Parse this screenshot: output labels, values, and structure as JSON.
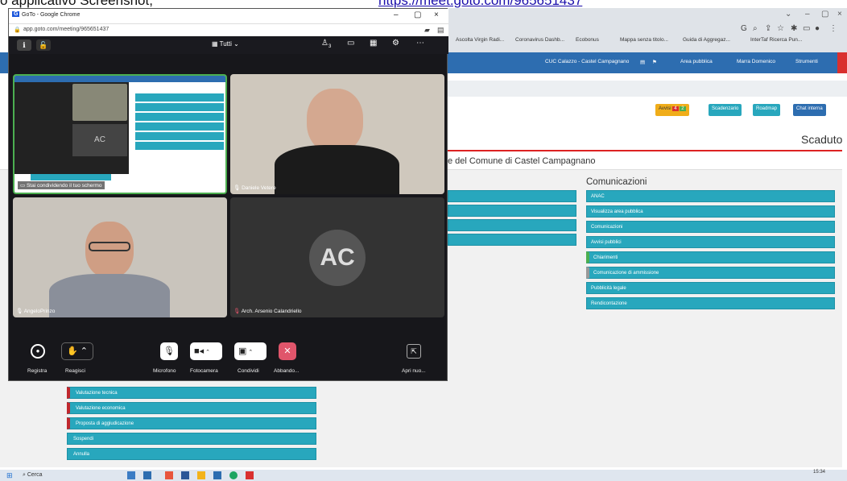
{
  "doc": {
    "text": "o applicativo Screenshot,",
    "link": "https://meet.goto.com/965651437"
  },
  "bg_browser": {
    "bookmarks": [
      "Ascolta Virgin Radi...",
      "Coronavirus Dashb...",
      "Ecobonus",
      "Mappa senza titolo...",
      "Guida di Aggregaz...",
      "InterTaf Ricerca Pun..."
    ],
    "nav": [
      "CUC Calazzo - Castel Campagnano",
      "Area pubblica",
      "Marra Domenico",
      "Strumenti"
    ],
    "buttons": {
      "avvisi": "Avvisi",
      "avvisi_count_red": "4",
      "avvisi_count_green": "2",
      "scadenzario": "Scadenzario",
      "roadmap": "Roadmap",
      "chat": "Chat interna"
    },
    "scaduto": "Scaduto",
    "page_title": "e del Comune di Castel Campagnano",
    "comunicazioni_title": "Comunicazioni",
    "comunicazioni": [
      "ANAC",
      "Visualizza area pubblica",
      "Comunicazioni",
      "Avvisi pubblici",
      "Chiarimenti",
      "Comunicazione di ammissione",
      "Pubblicità legale",
      "Rendicontazione"
    ],
    "bottom_list": [
      "Valutazione tecnica",
      "Valutazione economica",
      "Proposta di aggiudicazione",
      "Sospendi",
      "Annulla"
    ],
    "taskbar_search": "Cerca",
    "taskbar_time": "15:34"
  },
  "goto": {
    "window_title": "GoTo - Google Chrome",
    "url": "app.goto.com/meeting/965651437",
    "view_label": "Tutti",
    "participants_count": "3",
    "tiles": [
      "Stai condividendo il tuo schermo",
      "Daniele Vetere",
      "AngeloPrinzo",
      "Arch. Arsenio Calandriello"
    ],
    "avatar_initials": "AC",
    "controls": [
      "Registra",
      "Reagisci",
      "Microfono",
      "Fotocamera",
      "Condividi",
      "Abbando...",
      "Apri nuo..."
    ]
  }
}
